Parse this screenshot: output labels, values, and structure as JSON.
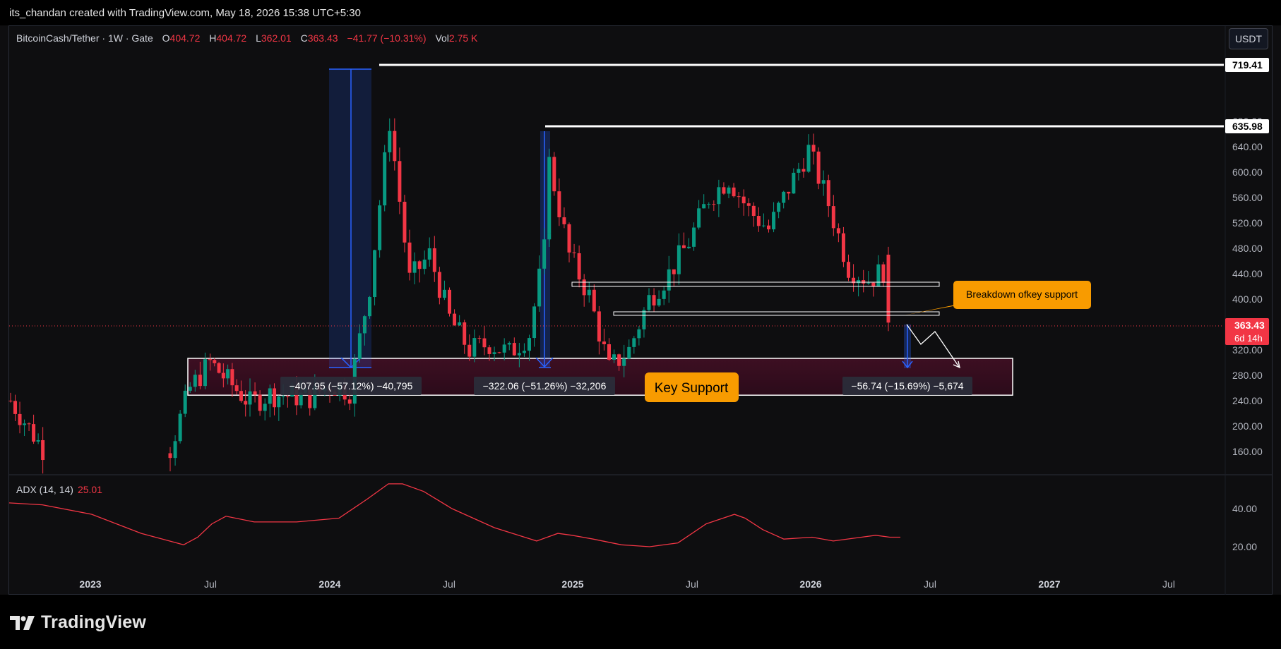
{
  "header": {
    "credit": "its_chandan created with TradingView.com, May 18, 2026 15:38 UTC+5:30"
  },
  "legend": {
    "symbol": "BitcoinCash/Tether · 1W · Gate",
    "o_label": "O",
    "o_value": "404.72",
    "h_label": "H",
    "h_value": "404.72",
    "l_label": "L",
    "l_value": "362.01",
    "c_label": "C",
    "c_value": "363.43",
    "change": "−41.77 (−10.31%)",
    "vol_label": "Vol",
    "vol_value": "2.75 K"
  },
  "currency_button": "USDT",
  "adx": {
    "label": "ADX (14, 14)",
    "value": "25.01"
  },
  "brand": "TradingView",
  "colors": {
    "up": "#089981",
    "down": "#f23645",
    "adx_line": "#f23645",
    "measure": "#2962ff",
    "callout": "#f89b00"
  },
  "chart_data": {
    "type": "candlestick",
    "price_axis": {
      "ticks": [
        "160.00",
        "200.00",
        "240.00",
        "280.00",
        "320.00",
        "360.00",
        "400.00",
        "440.00",
        "480.00",
        "520.00",
        "560.00",
        "600.00",
        "640.00",
        "680.00"
      ],
      "range": [
        155,
        735
      ]
    },
    "time_axis": {
      "ticks": [
        "2023",
        "Jul",
        "2024",
        "Jul",
        "2025",
        "Jul",
        "2026",
        "Jul",
        "2027",
        "Jul"
      ]
    },
    "price_labels": {
      "resistance_high": "719.41",
      "resistance_mid": "635.98",
      "last_price": "363.43",
      "countdown": "6d 14h"
    },
    "measurements": [
      {
        "label": "−407.95 (−57.12%) −40,795"
      },
      {
        "label": "−322.06 (−51.26%) −32,206"
      },
      {
        "label": "−56.74 (−15.69%) −5,674"
      }
    ],
    "annotations": {
      "key_support": "Key Support",
      "breakdown": "Breakdown ofkey support"
    },
    "support_zone": [
      262,
      300
    ],
    "adx_axis": {
      "ticks": [
        "20.00",
        "40.00"
      ]
    },
    "adx_last": 25.01,
    "anchors": [
      [
        "2022-09",
        240
      ],
      [
        "2022-12",
        100
      ],
      [
        "2023-02",
        80
      ],
      [
        "2023-03",
        95
      ],
      [
        "2023-05",
        165
      ],
      [
        "2023-06",
        260
      ],
      [
        "2023-07",
        300
      ],
      [
        "2023-09",
        236
      ],
      [
        "2023-10",
        250
      ],
      [
        "2023-12",
        245
      ],
      [
        "2024-01",
        265
      ],
      [
        "2024-02",
        255
      ],
      [
        "2024-03",
        420
      ],
      [
        "2024-04",
        680
      ],
      [
        "2024-05",
        430
      ],
      [
        "2024-06",
        470
      ],
      [
        "2024-07",
        370
      ],
      [
        "2024-08",
        320
      ],
      [
        "2024-09",
        330
      ],
      [
        "2024-10",
        315
      ],
      [
        "2024-11",
        345
      ],
      [
        "2024-12",
        520
      ],
      [
        "2024-12",
        615
      ],
      [
        "2025-01",
        470
      ],
      [
        "2025-02",
        405
      ],
      [
        "2025-03",
        290
      ],
      [
        "2025-04",
        320
      ],
      [
        "2025-05",
        400
      ],
      [
        "2025-06",
        440
      ],
      [
        "2025-07",
        490
      ],
      [
        "2025-08",
        560
      ],
      [
        "2025-09",
        590
      ],
      [
        "2025-10",
        540
      ],
      [
        "2025-11",
        510
      ],
      [
        "2025-12",
        575
      ],
      [
        "2026-01",
        635
      ],
      [
        "2026-02",
        550
      ],
      [
        "2026-03",
        450
      ],
      [
        "2026-04",
        430
      ],
      [
        "2026-05",
        450
      ],
      [
        "2026-05",
        363
      ]
    ]
  }
}
